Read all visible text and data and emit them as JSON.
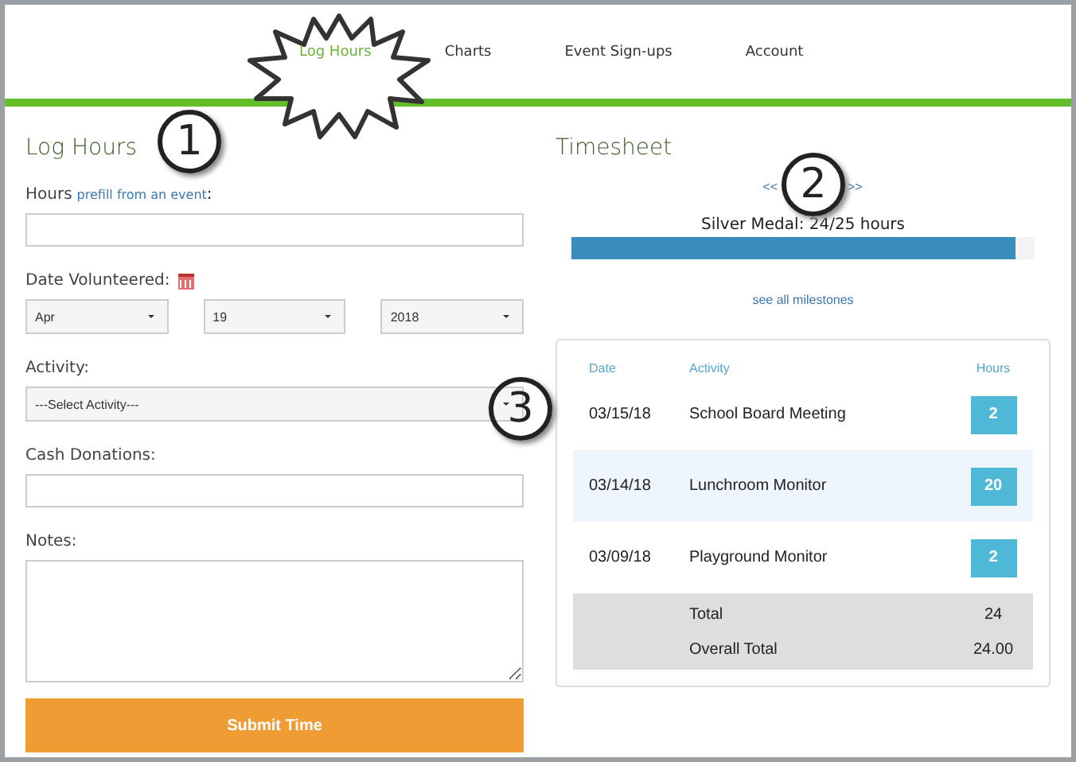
{
  "nav": [
    {
      "label": "Log Hours",
      "selected": true
    },
    {
      "label": "Charts",
      "selected": false
    },
    {
      "label": "Event Sign-ups",
      "selected": false
    },
    {
      "label": "Account",
      "selected": false
    }
  ],
  "log_hours": {
    "title": "Log Hours",
    "hours_label": "Hours",
    "prefill_link": "prefill from an event",
    "prefill_colon": ":",
    "date_label": "Date Volunteered:",
    "month": "Apr",
    "day": "19",
    "year": "2018",
    "activity_label": "Activity:",
    "activity_placeholder": "---Select Activity---",
    "cash_label": "Cash Donations:",
    "notes_label": "Notes:",
    "submit": "Submit Time"
  },
  "timesheet": {
    "title": "Timesheet",
    "prev": "<<",
    "next": ">>",
    "milestone": "Silver Medal: 24/25 hours",
    "level": 0.96,
    "milestones_link": "see all milestones",
    "columns": [
      "Date",
      "Activity",
      "Hours"
    ],
    "rows": [
      {
        "date": "03/15/18",
        "activity": "School Board Meeting",
        "hours": "2",
        "highlighted": false
      },
      {
        "date": "03/14/18",
        "activity": "Lunchroom Monitor",
        "hours": "20",
        "highlighted": true
      },
      {
        "date": "03/09/18",
        "activity": "Playground Monitor",
        "hours": "2",
        "highlighted": false
      }
    ],
    "totals": [
      {
        "label": "Total",
        "value": "24"
      },
      {
        "label": "Overall Total",
        "value": "24.00"
      }
    ]
  },
  "callouts": [
    "1",
    "2",
    "3"
  ]
}
